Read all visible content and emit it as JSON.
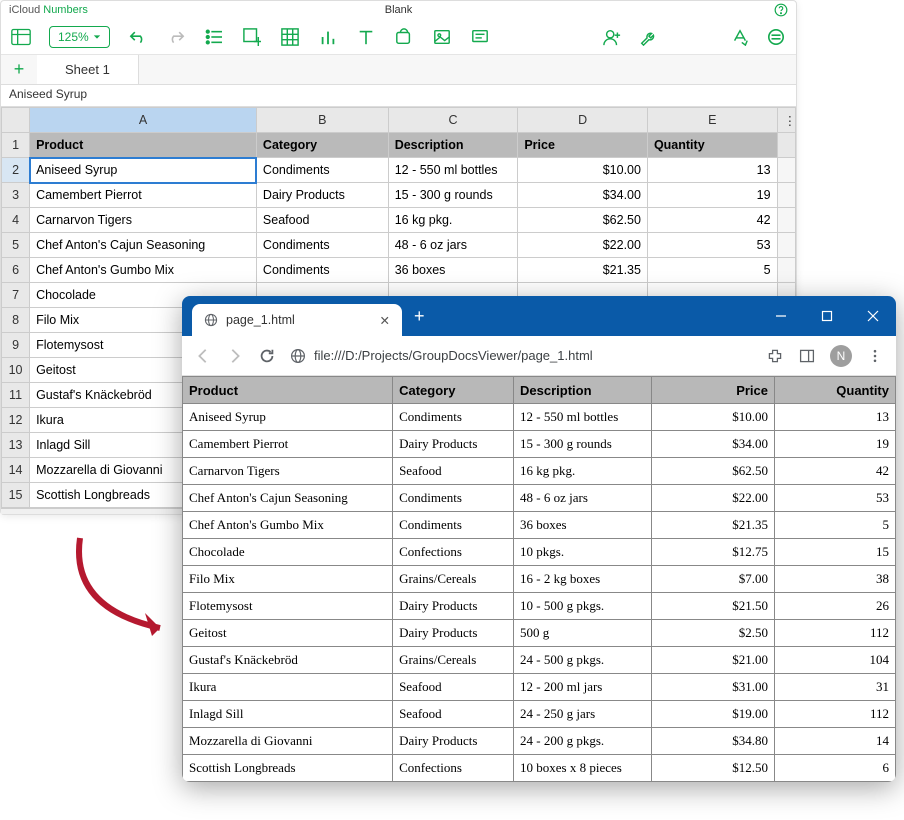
{
  "numbers": {
    "brand_prefix": "iCloud ",
    "brand_name": "Numbers",
    "doc_title": "Blank",
    "zoom": "125%",
    "sheet_tab": "Sheet 1",
    "formula": "Aniseed Syrup",
    "col_heads": [
      "A",
      "B",
      "C",
      "D",
      "E"
    ],
    "header_cells": [
      "Product",
      "Category",
      "Description",
      "Price",
      "Quantity"
    ],
    "rows": [
      {
        "n": "2",
        "c": [
          "Aniseed Syrup",
          "Condiments",
          "12 - 550 ml bottles",
          "$10.00",
          "13"
        ],
        "selected": true
      },
      {
        "n": "3",
        "c": [
          "Camembert Pierrot",
          "Dairy Products",
          "15 - 300 g rounds",
          "$34.00",
          "19"
        ]
      },
      {
        "n": "4",
        "c": [
          "Carnarvon Tigers",
          "Seafood",
          "16 kg pkg.",
          "$62.50",
          "42"
        ]
      },
      {
        "n": "5",
        "c": [
          "Chef Anton's Cajun Seasoning",
          "Condiments",
          "48 - 6 oz jars",
          "$22.00",
          "53"
        ]
      },
      {
        "n": "6",
        "c": [
          "Chef Anton's Gumbo Mix",
          "Condiments",
          "36 boxes",
          "$21.35",
          "5"
        ]
      },
      {
        "n": "7",
        "c": [
          "Chocolade",
          "",
          "",
          "",
          ""
        ]
      },
      {
        "n": "8",
        "c": [
          "Filo Mix",
          "",
          "",
          "",
          ""
        ]
      },
      {
        "n": "9",
        "c": [
          "Flotemysost",
          "",
          "",
          "",
          ""
        ]
      },
      {
        "n": "10",
        "c": [
          "Geitost",
          "",
          "",
          "",
          ""
        ]
      },
      {
        "n": "11",
        "c": [
          "Gustaf's Knäckebröd",
          "",
          "",
          "",
          ""
        ]
      },
      {
        "n": "12",
        "c": [
          "Ikura",
          "",
          "",
          "",
          ""
        ]
      },
      {
        "n": "13",
        "c": [
          "Inlagd Sill",
          "",
          "",
          "",
          ""
        ]
      },
      {
        "n": "14",
        "c": [
          "Mozzarella di Giovanni",
          "",
          "",
          "",
          ""
        ]
      },
      {
        "n": "15",
        "c": [
          "Scottish Longbreads",
          "",
          "",
          "",
          ""
        ]
      }
    ]
  },
  "browser": {
    "tab_title": "page_1.html",
    "url": "file:///D:/Projects/GroupDocsViewer/page_1.html",
    "avatar_letter": "N",
    "headers": [
      "Product",
      "Category",
      "Description",
      "Price",
      "Quantity"
    ],
    "rows": [
      [
        "Aniseed Syrup",
        "Condiments",
        "12 - 550 ml bottles",
        "$10.00",
        "13"
      ],
      [
        "Camembert Pierrot",
        "Dairy Products",
        "15 - 300 g rounds",
        "$34.00",
        "19"
      ],
      [
        "Carnarvon Tigers",
        "Seafood",
        "16 kg pkg.",
        "$62.50",
        "42"
      ],
      [
        "Chef Anton's Cajun Seasoning",
        "Condiments",
        "48 - 6 oz jars",
        "$22.00",
        "53"
      ],
      [
        "Chef Anton's Gumbo Mix",
        "Condiments",
        "36 boxes",
        "$21.35",
        "5"
      ],
      [
        "Chocolade",
        "Confections",
        "10 pkgs.",
        "$12.75",
        "15"
      ],
      [
        "Filo Mix",
        "Grains/Cereals",
        "16 - 2 kg boxes",
        "$7.00",
        "38"
      ],
      [
        "Flotemysost",
        "Dairy Products",
        "10 - 500 g pkgs.",
        "$21.50",
        "26"
      ],
      [
        "Geitost",
        "Dairy Products",
        "500 g",
        "$2.50",
        "112"
      ],
      [
        "Gustaf's Knäckebröd",
        "Grains/Cereals",
        "24 - 500 g pkgs.",
        "$21.00",
        "104"
      ],
      [
        "Ikura",
        "Seafood",
        "12 - 200 ml jars",
        "$31.00",
        "31"
      ],
      [
        "Inlagd Sill",
        "Seafood",
        "24 - 250 g  jars",
        "$19.00",
        "112"
      ],
      [
        "Mozzarella di Giovanni",
        "Dairy Products",
        "24 - 200 g pkgs.",
        "$34.80",
        "14"
      ],
      [
        "Scottish Longbreads",
        "Confections",
        "10 boxes x 8 pieces",
        "$12.50",
        "6"
      ]
    ]
  }
}
